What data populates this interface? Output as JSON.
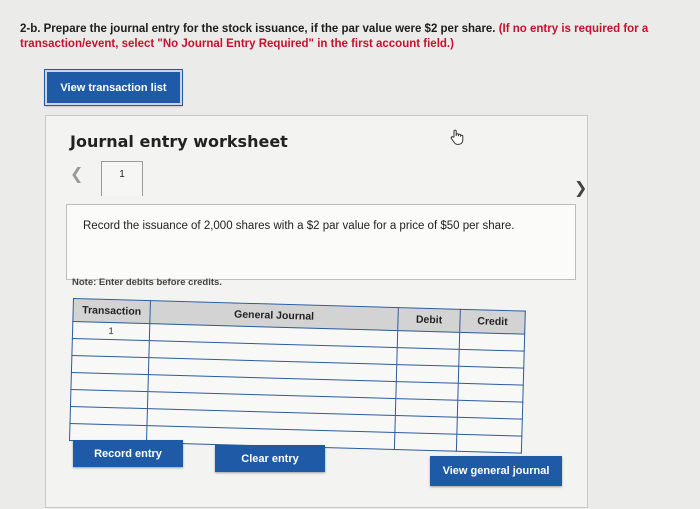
{
  "question": {
    "prefix": "2-b. Prepare the journal entry for the stock issuance, if the par value were $2 per share.",
    "hint": "(If no entry is required for a transaction/event, select \"No Journal Entry Required\" in the first account field.)"
  },
  "buttons": {
    "view_transaction_list": "View transaction list",
    "record_entry": "Record entry",
    "clear_entry": "Clear entry",
    "view_general_journal": "View general journal"
  },
  "worksheet": {
    "title": "Journal entry worksheet",
    "page_tab": "1",
    "instruction": "Record the issuance of 2,000 shares with a $2 par value for a price of $50 per share.",
    "note": "Note: Enter debits before credits."
  },
  "table": {
    "headers": [
      "Transaction",
      "General Journal",
      "Debit",
      "Credit"
    ],
    "rows": [
      {
        "transaction": "1",
        "account": "",
        "debit": "",
        "credit": ""
      },
      {
        "transaction": "",
        "account": "",
        "debit": "",
        "credit": ""
      },
      {
        "transaction": "",
        "account": "",
        "debit": "",
        "credit": ""
      },
      {
        "transaction": "",
        "account": "",
        "debit": "",
        "credit": ""
      },
      {
        "transaction": "",
        "account": "",
        "debit": "",
        "credit": ""
      },
      {
        "transaction": "",
        "account": "",
        "debit": "",
        "credit": ""
      },
      {
        "transaction": "",
        "account": "",
        "debit": "",
        "credit": ""
      }
    ]
  },
  "colors": {
    "button_blue": "#1f5aa6",
    "hint_red": "#c8102e",
    "grid_blue": "#2c5aa0"
  },
  "icons": [
    "hand-pointer-icon",
    "chevron-left-icon",
    "chevron-right-icon"
  ]
}
